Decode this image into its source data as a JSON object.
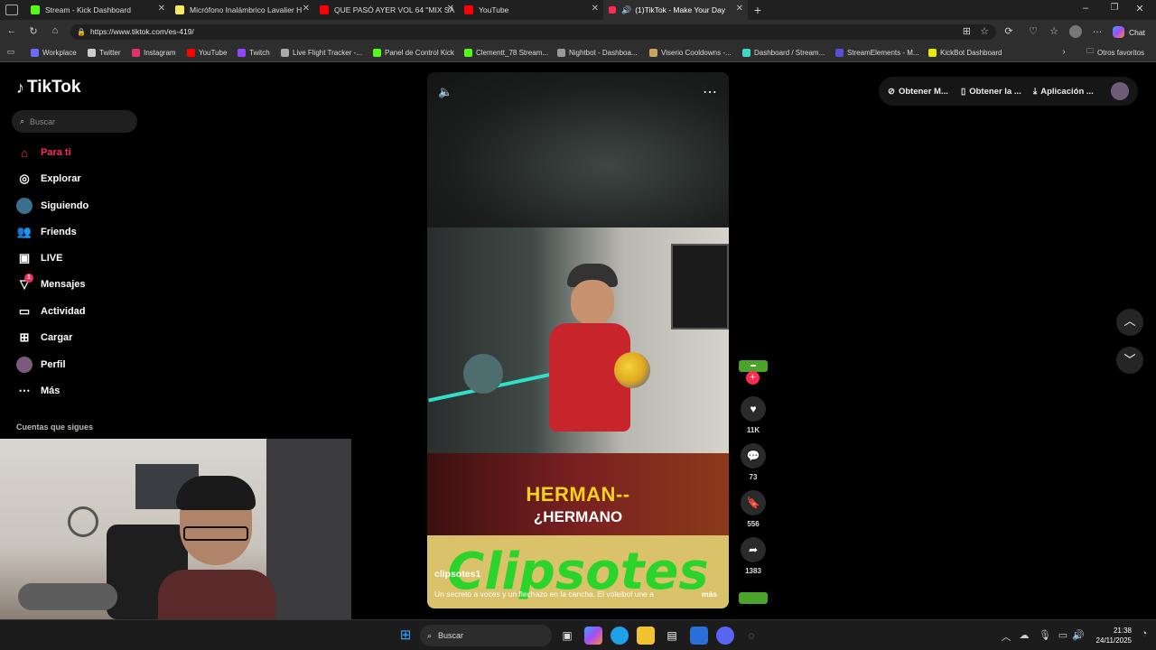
{
  "browser": {
    "tabs": [
      {
        "title": "Stream - Kick Dashboard",
        "color": "#53fc18"
      },
      {
        "title": "Micrófono Inalámbrico Lavalier H",
        "color": "#f5e663"
      },
      {
        "title": "QUE PASÓ AYER VOL 64 \"MIX SA",
        "color": "#ff0000"
      },
      {
        "title": "YouTube",
        "color": "#ff0000"
      },
      {
        "title": "(1)TikTok - Make Your Day",
        "color": "#fe2c55"
      }
    ],
    "url": "https://www.tiktok.com/es-419/",
    "chat_label": "Chat",
    "bookmarks": [
      {
        "label": "Workplace",
        "color": "#6b6bff"
      },
      {
        "label": "Twitter",
        "color": "#cccccc"
      },
      {
        "label": "Instagram",
        "color": "#e1306c"
      },
      {
        "label": "YouTube",
        "color": "#ff0000"
      },
      {
        "label": "Twitch",
        "color": "#9146ff"
      },
      {
        "label": "Live Flight Tracker -...",
        "color": "#aaaaaa"
      },
      {
        "label": "Panel de Control Kick",
        "color": "#53fc18"
      },
      {
        "label": "Clementt_78 Stream...",
        "color": "#53fc18"
      },
      {
        "label": "Nightbot - Dashboa...",
        "color": "#999999"
      },
      {
        "label": "Viserio Cooldowns -...",
        "color": "#c9a45c"
      },
      {
        "label": "Dashboard / Stream...",
        "color": "#3ed6c4"
      },
      {
        "label": "StreamElements - M...",
        "color": "#5b4ed6"
      },
      {
        "label": "KickBot Dashboard",
        "color": "#e8e800"
      }
    ],
    "other_favorites": "Otros favoritos"
  },
  "tiktok": {
    "logo": "TikTok",
    "search_placeholder": "Buscar",
    "nav": [
      {
        "label": "Para ti",
        "icon": "home-icon",
        "active": true
      },
      {
        "label": "Explorar",
        "icon": "compass-icon"
      },
      {
        "label": "Siguiendo",
        "icon": "following-icon"
      },
      {
        "label": "Friends",
        "icon": "friends-icon"
      },
      {
        "label": "LIVE",
        "icon": "live-icon"
      },
      {
        "label": "Mensajes",
        "icon": "messages-icon",
        "badge": "1"
      },
      {
        "label": "Actividad",
        "icon": "activity-icon"
      },
      {
        "label": "Cargar",
        "icon": "upload-icon"
      },
      {
        "label": "Perfil",
        "icon": "profile-icon"
      },
      {
        "label": "Más",
        "icon": "more-icon"
      }
    ],
    "following_accounts_label": "Cuentas que sigues",
    "top_actions": [
      "Obtener M...",
      "Obtener la ...",
      "Aplicación ..."
    ],
    "video": {
      "caption_top": "HERMAN--",
      "caption_bottom": "¿HERMANO",
      "banner": "Clipsotes",
      "author": "clipsotes1",
      "description": "Un secreto a voces y un flechazo en la cancha. El voleibol une a",
      "more": "más"
    },
    "actions": {
      "likes": "11K",
      "comments": "73",
      "saves": "556",
      "shares": "1383"
    }
  },
  "taskbar": {
    "search": "Buscar",
    "time": "21:38",
    "date": "24/11/2025"
  }
}
